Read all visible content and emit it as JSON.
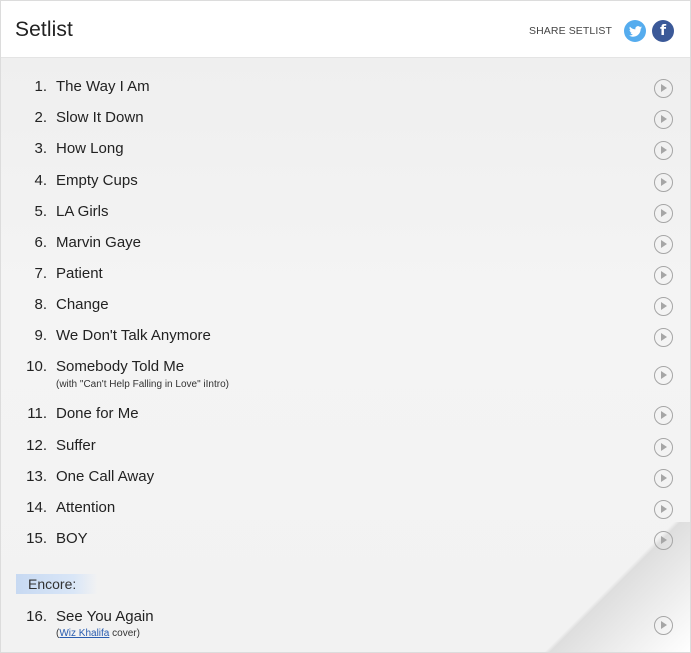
{
  "header": {
    "title": "Setlist",
    "share_label": "SHARE SETLIST",
    "twitter_icon": "twitter-icon",
    "facebook_icon": "facebook-icon",
    "facebook_glyph": "f"
  },
  "setlist": [
    {
      "num": "1.",
      "title": "The Way I Am"
    },
    {
      "num": "2.",
      "title": "Slow It Down"
    },
    {
      "num": "3.",
      "title": "How Long"
    },
    {
      "num": "4.",
      "title": "Empty Cups"
    },
    {
      "num": "5.",
      "title": "LA Girls"
    },
    {
      "num": "6.",
      "title": "Marvin Gaye"
    },
    {
      "num": "7.",
      "title": "Patient"
    },
    {
      "num": "8.",
      "title": "Change"
    },
    {
      "num": "9.",
      "title": "We Don't Talk Anymore"
    },
    {
      "num": "10.",
      "title": "Somebody Told Me",
      "note": "(with \"Can't Help Falling in Love\" iIntro)"
    },
    {
      "num": "11.",
      "title": "Done for Me"
    },
    {
      "num": "12.",
      "title": "Suffer"
    },
    {
      "num": "13.",
      "title": "One Call Away"
    },
    {
      "num": "14.",
      "title": "Attention"
    },
    {
      "num": "15.",
      "title": "BOY"
    }
  ],
  "encore": {
    "label": "Encore:",
    "songs": [
      {
        "num": "16.",
        "title": "See You Again",
        "note_open": "(",
        "note_link": "Wiz Khalifa",
        "note_close": " cover)"
      }
    ]
  },
  "colors": {
    "twitter": "#55acee",
    "facebook": "#3b5998",
    "encore_highlight": "#c7d9f2",
    "link": "#2a5db0"
  }
}
